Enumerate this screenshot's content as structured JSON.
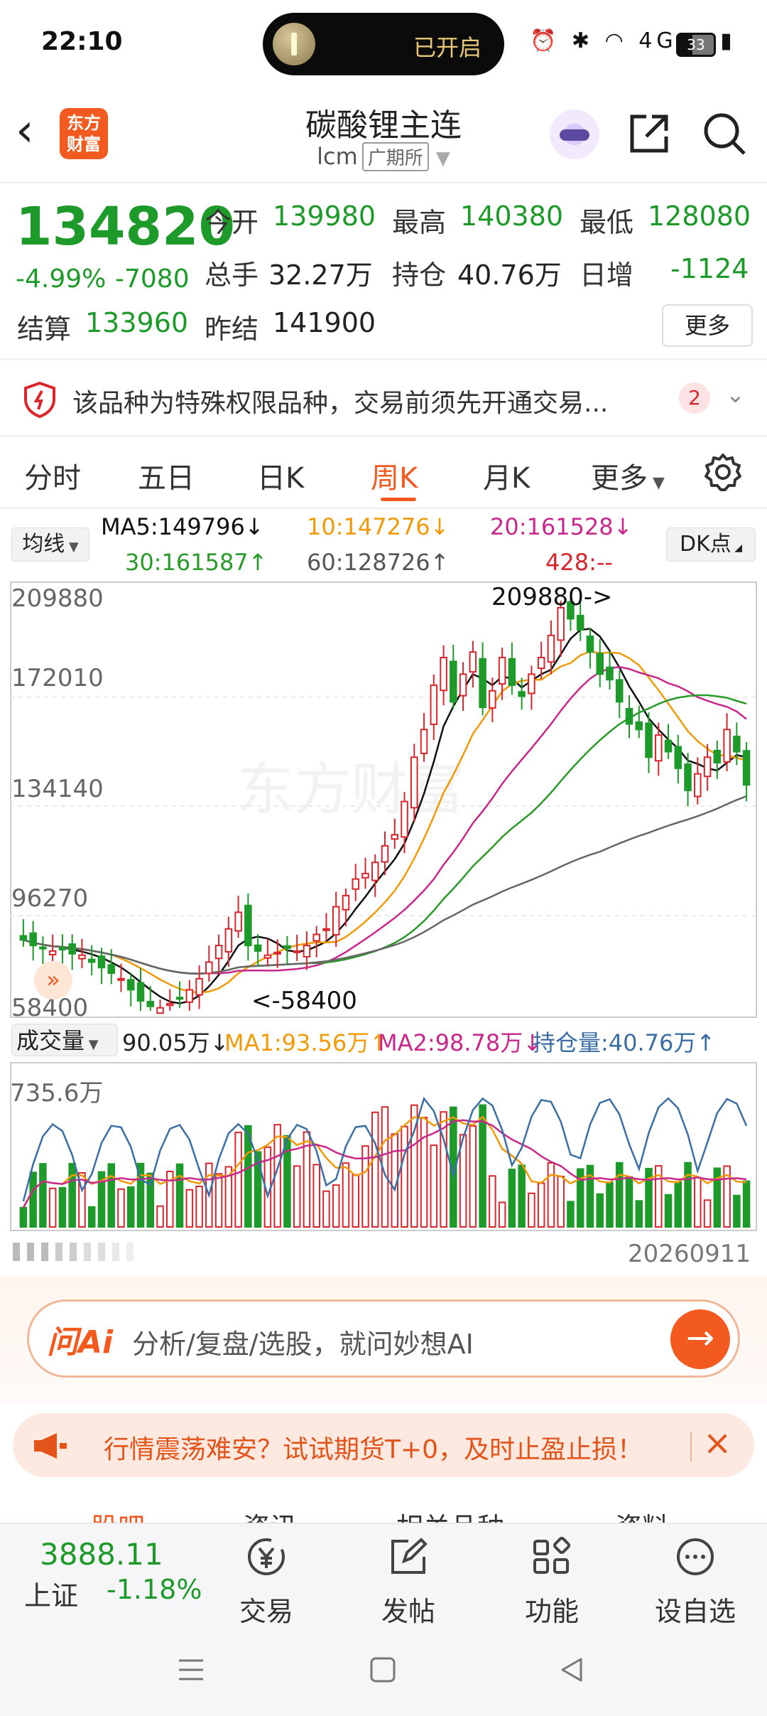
{
  "status_bar": {
    "time": "22:10",
    "island_text": "已开启",
    "icons": "⏰ ✱ ◠ 4G ▮▮▮",
    "battery": "33"
  },
  "header": {
    "title": "碳酸锂主连",
    "code": "lcm",
    "exchange": "广期所",
    "logo_line1": "东方",
    "logo_line2": "财富"
  },
  "quote": {
    "price": "134820",
    "change_pct": "-4.99%",
    "change": "-7080",
    "open_label": "今开",
    "open": "139980",
    "high_label": "最高",
    "high": "140380",
    "low_label": "最低",
    "low": "128080",
    "volume_label": "总手",
    "volume": "32.27万",
    "oi_label": "持仓",
    "oi": "40.76万",
    "daily_inc_label": "日增",
    "daily_inc": "-1124",
    "settle_label": "结算",
    "settle": "133960",
    "prev_settle_label": "昨结",
    "prev_settle": "141900",
    "more": "更多"
  },
  "notice": {
    "text": "该品种为特殊权限品种，交易前须先开通交易...",
    "badge": "2"
  },
  "tabs": [
    "分时",
    "五日",
    "日K",
    "周K",
    "月K",
    "更多"
  ],
  "active_tab": "周K",
  "ma": {
    "select": "均线",
    "ma5": "MA5:149796↓",
    "ma10": "10:147276↓",
    "ma20": "20:161528↓",
    "ma30": "30:161587↑",
    "ma60": "60:128726↑",
    "ma428": "428:--",
    "dk": "DK点"
  },
  "colors": {
    "up": "#d8262c",
    "down": "#1e9a2a",
    "ma5": "#111111",
    "ma10": "#f09a0a",
    "ma20": "#c8288c",
    "ma30": "#2a9a2a",
    "ma60": "#666666",
    "oi": "#3a6ea5",
    "accent": "#f25a1f"
  },
  "kline_axis": {
    "t1": "209880",
    "t2": "172010",
    "t3": "134140",
    "t4": "96270",
    "t5": "58400",
    "max_label": "209880->",
    "min_label": "<-58400"
  },
  "volume_legend": {
    "select": "成交量",
    "vol": "90.05万↓",
    "ma1": "MA1:93.56万↑",
    "ma2": "MA2:98.78万↓",
    "oi": "持仓量:40.76万↑",
    "max": "735.6万",
    "date": "20260911"
  },
  "chart_data": {
    "type": "candlestick",
    "kline_range": [
      58400,
      209880
    ],
    "closes": [
      84000,
      82000,
      81000,
      80000,
      80500,
      79000,
      78500,
      76000,
      74000,
      72000,
      70000,
      66000,
      62000,
      60000,
      59500,
      61000,
      63000,
      66000,
      70000,
      76000,
      82000,
      88000,
      94000,
      82000,
      80000,
      78500,
      79500,
      81000,
      80000,
      82000,
      86000,
      88000,
      96000,
      100000,
      106000,
      108000,
      112000,
      118000,
      122000,
      134000,
      150000,
      160000,
      176000,
      186000,
      170000,
      180000,
      188000,
      168000,
      174000,
      186000,
      176000,
      172000,
      180000,
      186000,
      194000,
      204000,
      200000,
      196000,
      188000,
      180000,
      178000,
      170000,
      162000,
      160000,
      150000,
      158000,
      152000,
      146000,
      138000,
      144000,
      150000,
      148000,
      160000,
      152000,
      140000
    ],
    "volume_max": "735.6万"
  },
  "ai": {
    "logo": "问Ai",
    "placeholder": "分析/复盘/选股，就问妙想AI"
  },
  "promo": {
    "text": "行情震荡难安？试试期货T+0，及时止盈止损！"
  },
  "cut_tabs": [
    "股吧",
    "资讯",
    "相关品种",
    "资料"
  ],
  "bottom_nav": {
    "index_value": "3888.11",
    "index_name": "上证",
    "index_change": "-1.18%",
    "trade": "交易",
    "post": "发帖",
    "function": "功能",
    "watch": "设自选"
  }
}
